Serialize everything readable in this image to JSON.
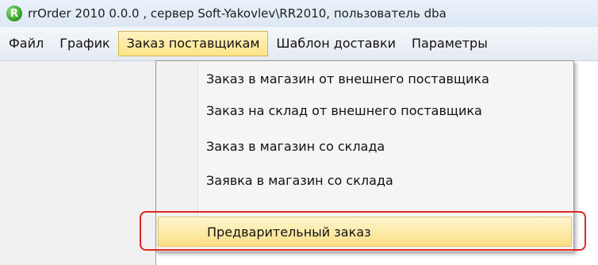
{
  "window": {
    "title": "rrOrder 2010 0.0.0 , сервер Soft-Yakovlev\\RR2010, пользователь dba",
    "icon": "app-logo-icon",
    "icon_glyph": "R"
  },
  "menubar": {
    "items": [
      "Файл",
      "График",
      "Заказ поставщикам",
      "Шаблон доставки",
      "Параметры"
    ],
    "active_index": 2
  },
  "dropdown": {
    "items": [
      "Заказ в магазин от внешнего поставщика",
      "Заказ на склад от внешнего поставщика",
      "Заказ в магазин со склада",
      "Заявка в магазин со склада",
      "Предварительный заказ"
    ],
    "highlighted_index": 4
  },
  "colors": {
    "highlight": "#fde488",
    "callout": "#e02626"
  }
}
